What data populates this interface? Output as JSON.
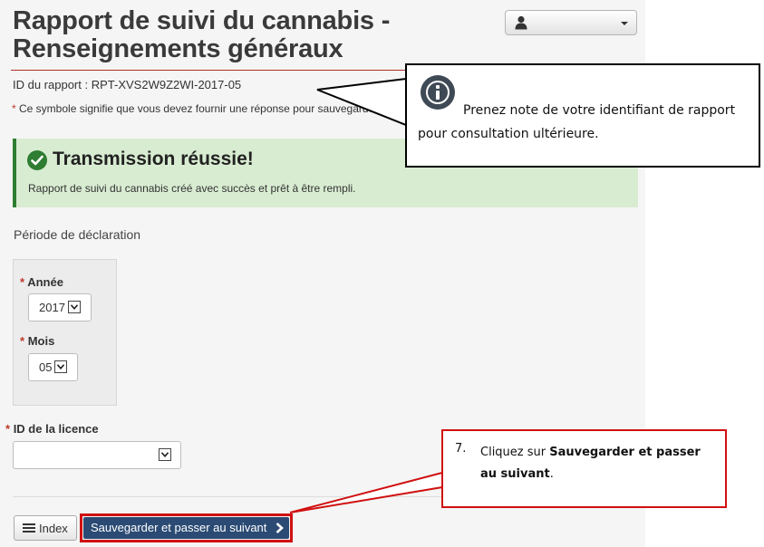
{
  "header": {
    "title_line1": "Rapport de suivi du cannabis -",
    "title_line2": "Renseignements généraux",
    "user_icon": "user-icon",
    "dropdown_icon": "caret-down-icon"
  },
  "report": {
    "id_label": "ID du rapport : RPT-XVS2W9Z2WI-2017-05"
  },
  "required_note": {
    "star": "*",
    "text": " Ce symbole signifie que vous devez fournir une réponse pour sauvegarder"
  },
  "alert": {
    "icon": "check-circle-icon",
    "heading": "Transmission réussie!",
    "message": "Rapport de suivi du cannabis créé avec succès et prêt à être rempli.",
    "color": "#2e7d32",
    "background": "#d8ecd1"
  },
  "period": {
    "label": "Période de déclaration",
    "year": {
      "star": "*",
      "label": "Année",
      "value": "2017"
    },
    "month": {
      "star": "*",
      "label": "Mois",
      "value": "05"
    }
  },
  "licence": {
    "star": "*",
    "label": "ID de la licence",
    "value": ""
  },
  "buttons": {
    "index_icon": "list-icon",
    "index_label": "Index",
    "save_label": "Sauvegarder et passer au suivant",
    "save_icon": "chevron-right-icon",
    "save_color": "#2b4b74"
  },
  "callouts": {
    "info": {
      "icon": "info-icon",
      "text": "Prenez note de votre identifiant de rapport pour consultation ultérieure."
    },
    "step": {
      "number": "7.",
      "prefix": "Cliquez sur ",
      "bold": "Sauvegarder et passer au suivant",
      "suffix": ".",
      "border_color": "#d01010"
    }
  }
}
